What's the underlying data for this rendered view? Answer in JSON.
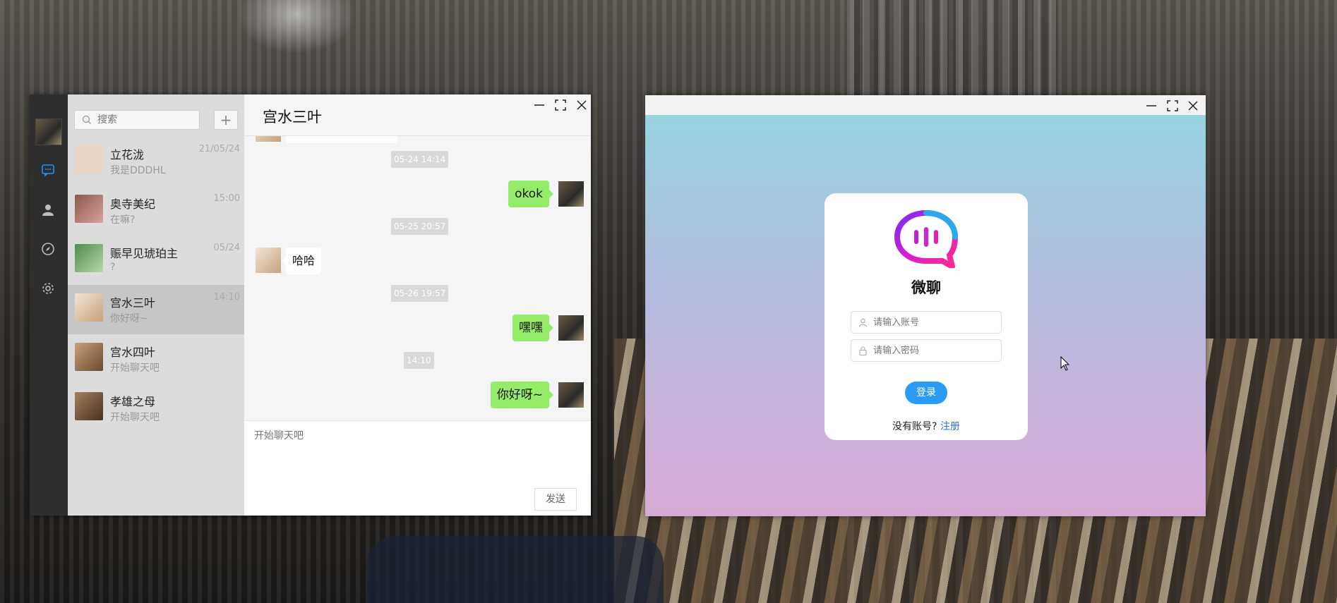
{
  "chat_app": {
    "search": {
      "placeholder": "搜索"
    },
    "add_label": "+",
    "conversations": [
      {
        "name": "立花泷",
        "last_message": "我是DDDHL",
        "time": "21/05/24",
        "avatar_color": "#e8d7c7"
      },
      {
        "name": "奥寺美纪",
        "last_message": "在嘛?",
        "time": "15:00",
        "avatar_color": "#8a5a4a"
      },
      {
        "name": "赈早见琥珀主",
        "last_message": "?",
        "time": "05/24",
        "avatar_color": "#6aa36a"
      },
      {
        "name": "宫水三叶",
        "last_message": "你好呀~",
        "time": "14:10",
        "avatar_color": "#f0e6d8"
      },
      {
        "name": "宫水四叶",
        "last_message": "开始聊天吧",
        "time": "",
        "avatar_color": "#c9a07a"
      },
      {
        "name": "孝雄之母",
        "last_message": "开始聊天吧",
        "time": "",
        "avatar_color": "#a08060"
      }
    ],
    "active_conversation": "宫水三叶",
    "header_title": "宫水三叶",
    "messages": [
      {
        "type": "time",
        "text": "05-24 14:14"
      },
      {
        "type": "sent",
        "text": "okok"
      },
      {
        "type": "time",
        "text": "05-25 20:57"
      },
      {
        "type": "received",
        "text": "哈哈"
      },
      {
        "type": "time",
        "text": "05-26 19:57"
      },
      {
        "type": "sent",
        "text": "嘿嘿"
      },
      {
        "type": "time",
        "text": "14:10"
      },
      {
        "type": "sent",
        "text": "你好呀~"
      }
    ],
    "input_placeholder": "开始聊天吧",
    "send_label": "发送",
    "nav_icons": [
      "avatar",
      "chat-icon",
      "contacts-icon",
      "discover-icon",
      "settings-icon"
    ]
  },
  "login_app": {
    "app_name": "微聊",
    "account_placeholder": "请输入账号",
    "password_placeholder": "请输入密码",
    "login_label": "登录",
    "no_account_text": "没有账号?",
    "register_label": "注册"
  },
  "colors": {
    "sent_bubble": "#95ec69",
    "login_button": "#2a9cf4",
    "register_link": "#2a6fd6",
    "chat_nav_bg": "#2e2e2e"
  }
}
